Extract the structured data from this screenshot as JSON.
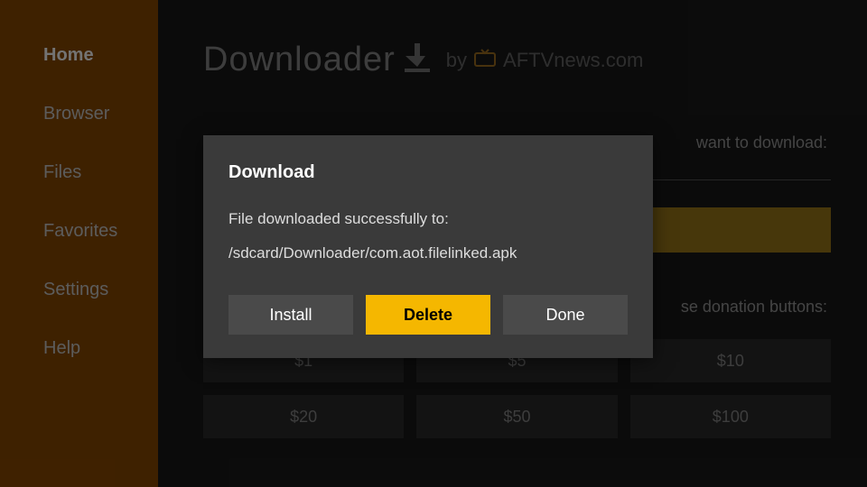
{
  "sidebar": {
    "items": [
      {
        "label": "Home",
        "active": true
      },
      {
        "label": "Browser",
        "active": false
      },
      {
        "label": "Files",
        "active": false
      },
      {
        "label": "Favorites",
        "active": false
      },
      {
        "label": "Settings",
        "active": false
      },
      {
        "label": "Help",
        "active": false
      }
    ]
  },
  "header": {
    "title": "Downloader",
    "by": "by",
    "site": "AFTVnews.com"
  },
  "main": {
    "prompt_tail": "want to download:",
    "donate_tail": "se donation buttons:",
    "donate_row1": [
      "$1",
      "$5",
      "$10"
    ],
    "donate_row2": [
      "$20",
      "$50",
      "$100"
    ]
  },
  "modal": {
    "title": "Download",
    "message": "File downloaded successfully to:",
    "path": "/sdcard/Downloader/com.aot.filelinked.apk",
    "install": "Install",
    "delete": "Delete",
    "done": "Done"
  }
}
